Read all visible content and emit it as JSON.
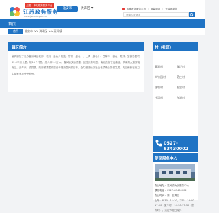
{
  "header": {
    "banner": "全国一体化政务服务平台",
    "title": "江苏政务服务",
    "url": "www.jszwfw.gov.cn",
    "region_pill": "淮安市",
    "region_select": "洪泽区 ▼",
    "top_links": [
      "国家政务服务平台",
      "屏幕阅读",
      "无障碍浏览"
    ],
    "search_placeholder": "请输入关键字"
  },
  "nav": {
    "home": "首页"
  },
  "breadcrumb": {
    "home": "首页",
    "path": "淮安市 >> 洪泽区 >> 高涧镇"
  },
  "intro": {
    "title": "镇区简介",
    "body": "高涧镇位于江苏省洪泽县北部，北与（县名）相连，东邻（县名）、二涧（镇名）、西南与（镇名）毗邻。全镇总面积82.9平方公里，辖11个村居，总人口3.2万人。高涧镇交通便捷，区位优势明显，南北连接宁连高速、洪泽湖大道穿境而过。近年来，镇党委、政府紧紧围绕建设幸福新高涧的目标，全力推进经济社会各项事业协调发展，先后荣获省级卫生镇等多项荣誉称号。"
  },
  "sidebar": {
    "village_title": "村（社区）",
    "villages": [
      "高涧村",
      "魏圩村",
      "大竹园村",
      "范庄村",
      "张墩村",
      "五里村",
      "庄湾村",
      "东湖村"
    ],
    "phone": "0527-83430002",
    "service_title": "便民服务中心",
    "service": {
      "address_label": "办公地址：",
      "address": "高涧镇为民服务中心",
      "phone_label": "联系电话：",
      "phone": "0527-83430002",
      "hours_label": "办公时间：",
      "hours": "周一至周五",
      "hours_detail": "上午：8:30—11:30，下午：14:00-17:00（夏令时）14:30-17:30（冬令时），法定节假日除外"
    }
  },
  "colors": {
    "primary": "#1f73c4",
    "banner_red": "#e33b2f"
  }
}
